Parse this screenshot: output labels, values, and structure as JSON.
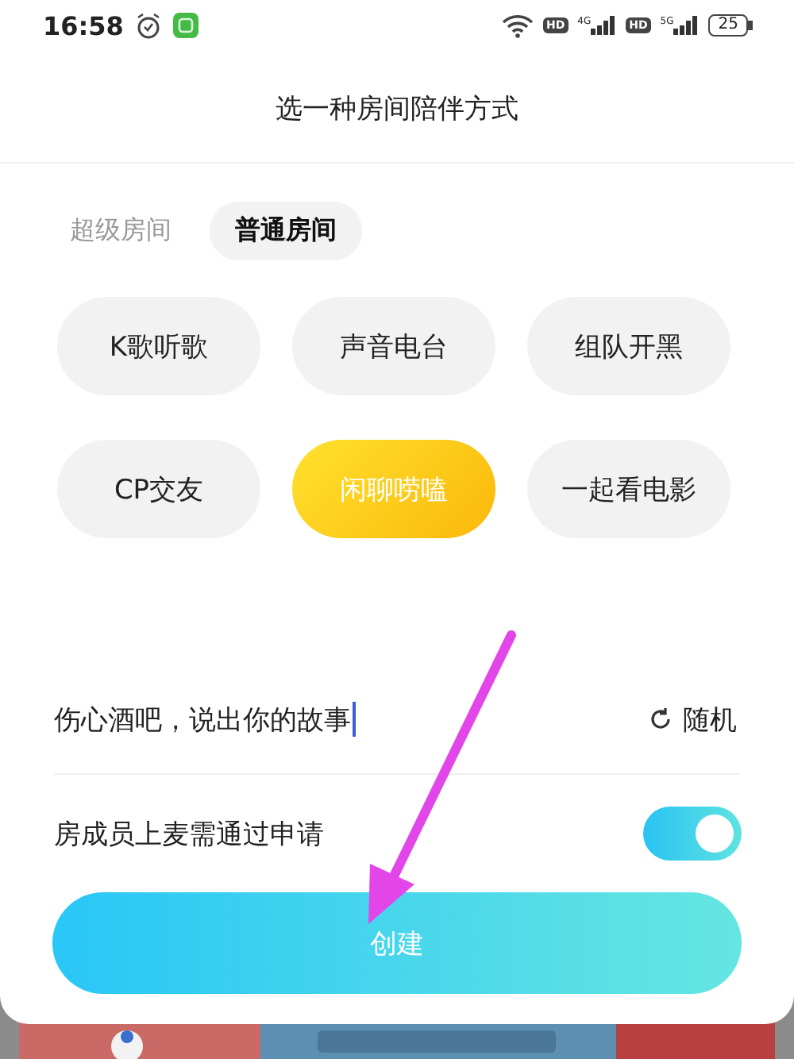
{
  "status_bar": {
    "time": "16:58",
    "signals": [
      {
        "hd": "HD",
        "tech": "4G"
      },
      {
        "hd": "HD",
        "tech": "5G"
      }
    ],
    "battery": "25"
  },
  "title": "选一种房间陪伴方式",
  "tabs": [
    {
      "label": "超级房间",
      "selected": false
    },
    {
      "label": "普通房间",
      "selected": true
    }
  ],
  "room_types": [
    {
      "label": "K歌听歌",
      "selected": false
    },
    {
      "label": "声音电台",
      "selected": false
    },
    {
      "label": "组队开黑",
      "selected": false
    },
    {
      "label": "CP交友",
      "selected": false
    },
    {
      "label": "闲聊唠嗑",
      "selected": true
    },
    {
      "label": "一起看电影",
      "selected": false
    }
  ],
  "topic": {
    "value": "伤心酒吧，说出你的故事",
    "random_button": "随机"
  },
  "approval": {
    "label": "房成员上麦需通过申请",
    "on": true
  },
  "create_button": "创建"
}
